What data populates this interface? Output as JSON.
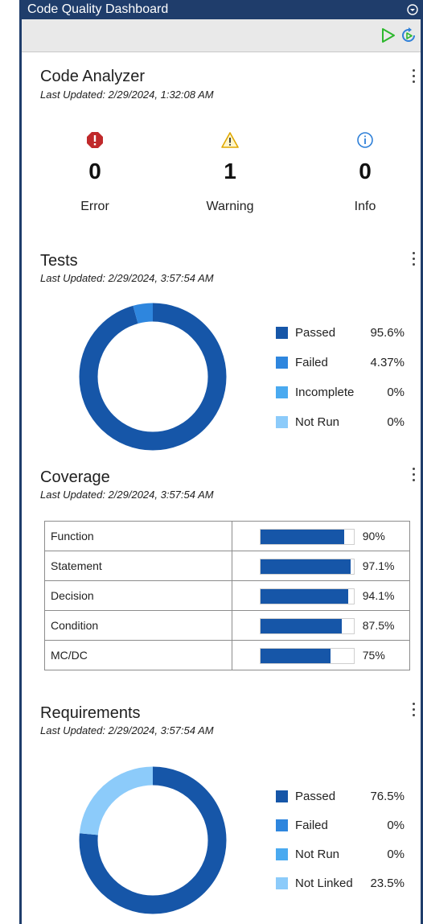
{
  "window": {
    "title": "Code Quality Dashboard"
  },
  "icons": {
    "panel_menu": "chevron-down-circle-icon",
    "run": "play-icon",
    "rerun": "rerun-icon",
    "error": "error-icon",
    "warning": "warning-icon",
    "info": "info-icon",
    "more": "kebab-menu-icon"
  },
  "colors": {
    "titlebar": "#1f3d6b",
    "passed": "#1656a8",
    "failed": "#2e86de",
    "incomplete": "#4aaaf0",
    "not_run": "#8ccbfa",
    "error": "#c0292b",
    "warning": "#e0a800",
    "info": "#2f80d8",
    "run": "#2eb82e"
  },
  "code_analyzer": {
    "title": "Code Analyzer",
    "updated": "Last Updated: 2/29/2024, 1:32:08 AM",
    "items": [
      {
        "count": "0",
        "label": "Error"
      },
      {
        "count": "1",
        "label": "Warning"
      },
      {
        "count": "0",
        "label": "Info"
      }
    ]
  },
  "tests": {
    "title": "Tests",
    "updated": "Last Updated: 2/29/2024, 3:57:54 AM",
    "legend": [
      {
        "label": "Passed",
        "value": "95.6%",
        "pct": 95.6,
        "color": "#1656a8"
      },
      {
        "label": "Failed",
        "value": "4.37%",
        "pct": 4.37,
        "color": "#2e86de"
      },
      {
        "label": "Incomplete",
        "value": "0%",
        "pct": 0,
        "color": "#4aaaf0"
      },
      {
        "label": "Not Run",
        "value": "0%",
        "pct": 0,
        "color": "#8ccbfa"
      }
    ]
  },
  "coverage": {
    "title": "Coverage",
    "updated": "Last Updated: 2/29/2024, 3:57:54 AM",
    "rows": [
      {
        "name": "Function",
        "value": "90%",
        "pct": 90
      },
      {
        "name": "Statement",
        "value": "97.1%",
        "pct": 97.1
      },
      {
        "name": "Decision",
        "value": "94.1%",
        "pct": 94.1
      },
      {
        "name": "Condition",
        "value": "87.5%",
        "pct": 87.5
      },
      {
        "name": "MC/DC",
        "value": "75%",
        "pct": 75
      }
    ]
  },
  "requirements": {
    "title": "Requirements",
    "updated": "Last Updated: 2/29/2024, 3:57:54 AM",
    "legend": [
      {
        "label": "Passed",
        "value": "76.5%",
        "pct": 76.5,
        "color": "#1656a8"
      },
      {
        "label": "Failed",
        "value": "0%",
        "pct": 0,
        "color": "#2e86de"
      },
      {
        "label": "Not Run",
        "value": "0%",
        "pct": 0,
        "color": "#4aaaf0"
      },
      {
        "label": "Not Linked",
        "value": "23.5%",
        "pct": 23.5,
        "color": "#8ccbfa"
      }
    ]
  }
}
